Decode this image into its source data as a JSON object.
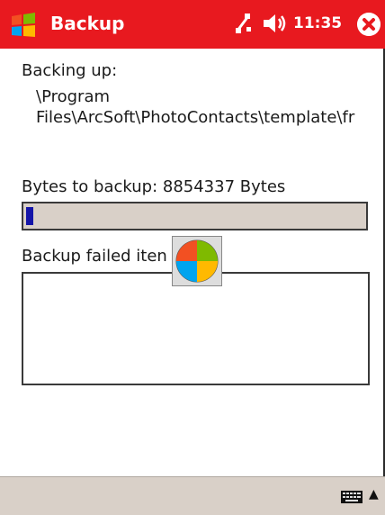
{
  "window": {
    "title": "Backup",
    "clock": "11:35"
  },
  "content": {
    "backing_up_label": "Backing up:",
    "path_line1": "\\Program",
    "path_line2": "Files\\ArcSoft\\PhotoContacts\\template\\fr",
    "bytes_label": "Bytes to backup: 8854337 Bytes",
    "progress": 0.02,
    "failed_label": "Backup failed iten"
  },
  "colors": {
    "titlebar": "#e8191f",
    "progress_fill": "#1515a8",
    "panel": "#d9d0c8"
  },
  "icons": [
    "windows-start-icon",
    "connectivity-icon",
    "volume-icon",
    "close-icon",
    "busy-indicator-icon",
    "keyboard-icon",
    "chevron-up-icon"
  ]
}
